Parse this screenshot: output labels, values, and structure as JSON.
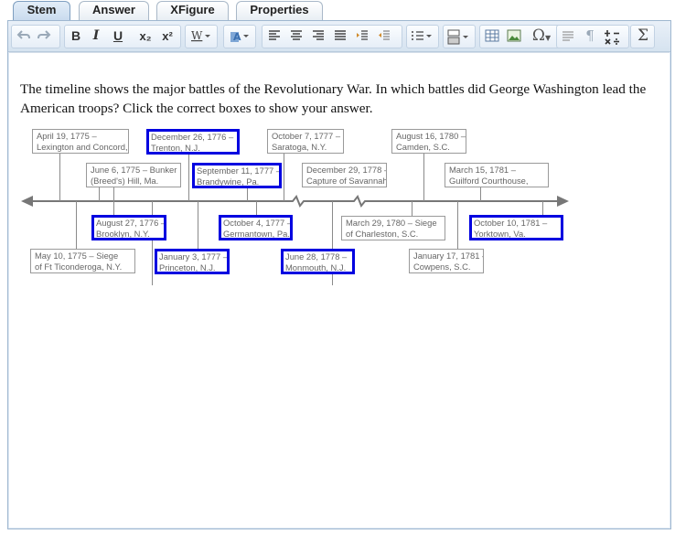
{
  "tabs": [
    {
      "label": "Stem",
      "active": true
    },
    {
      "label": "Answer",
      "active": false
    },
    {
      "label": "XFigure",
      "active": false
    },
    {
      "label": "Properties",
      "active": false
    }
  ],
  "toolbar": {
    "bold": "B",
    "italic": "I",
    "underline": "U",
    "subscript": "x₂",
    "superscript": "x²",
    "special_char": "Ω",
    "pilcrow": "¶",
    "sigma": "Σ",
    "icons": [
      "undo-icon",
      "redo-icon",
      "bold-icon",
      "italic-icon",
      "underline-icon",
      "subscript-icon",
      "superscript-icon",
      "word-style-icon",
      "font-color-icon",
      "align-left-icon",
      "align-center-icon",
      "align-right-icon",
      "justify-icon",
      "indent-icon",
      "outdent-icon",
      "list-icon",
      "block-style-icon",
      "table-icon",
      "image-icon",
      "omega-icon",
      "paragraph-icon",
      "show-blocks-icon",
      "math-ops-icon",
      "sigma-icon"
    ]
  },
  "question": "The timeline shows the major battles of the Revolutionary War. In which battles did George Washington lead the American troops? Click the correct boxes to show your answer.",
  "timeline": {
    "selected_color": "#0000e0",
    "events": [
      {
        "line1": "April 19, 1775 –",
        "line2": "Lexington and Concord,",
        "selected": false
      },
      {
        "line1": "December 26, 1776 –",
        "line2": "Trenton, N.J.",
        "selected": true
      },
      {
        "line1": "October 7, 1777 –",
        "line2": "Saratoga, N.Y.",
        "selected": false
      },
      {
        "line1": "August 16, 1780 –",
        "line2": "Camden, S.C.",
        "selected": false
      },
      {
        "line1": "June 6, 1775 – Bunker",
        "line2": "(Breed's) Hill, Ma.",
        "selected": false
      },
      {
        "line1": "September 11, 1777 –",
        "line2": "Brandywine, Pa.",
        "selected": true
      },
      {
        "line1": "December 29, 1778 –",
        "line2": "Capture of Savannah,",
        "selected": false
      },
      {
        "line1": "March 15, 1781 –",
        "line2": "Guilford Courthouse,",
        "selected": false
      },
      {
        "line1": "August 27, 1776 –",
        "line2": "Brooklyn, N.Y.",
        "selected": true
      },
      {
        "line1": "October 4, 1777 –",
        "line2": "Germantown, Pa.",
        "selected": true
      },
      {
        "line1": "March 29, 1780 – Siege",
        "line2": "of Charleston, S.C.",
        "selected": false
      },
      {
        "line1": "October 10, 1781 –",
        "line2": "Yorktown, Va.",
        "selected": true
      },
      {
        "line1": "May 10, 1775 – Siege",
        "line2": "of Ft Ticonderoga, N.Y.",
        "selected": false
      },
      {
        "line1": "January 3, 1777 –",
        "line2": "Princeton, N.J.",
        "selected": true
      },
      {
        "line1": "June 28, 1778 –",
        "line2": "Monmouth, N.J.",
        "selected": true
      },
      {
        "line1": "January 17, 1781 –",
        "line2": "Cowpens, S.C.",
        "selected": false
      }
    ]
  }
}
